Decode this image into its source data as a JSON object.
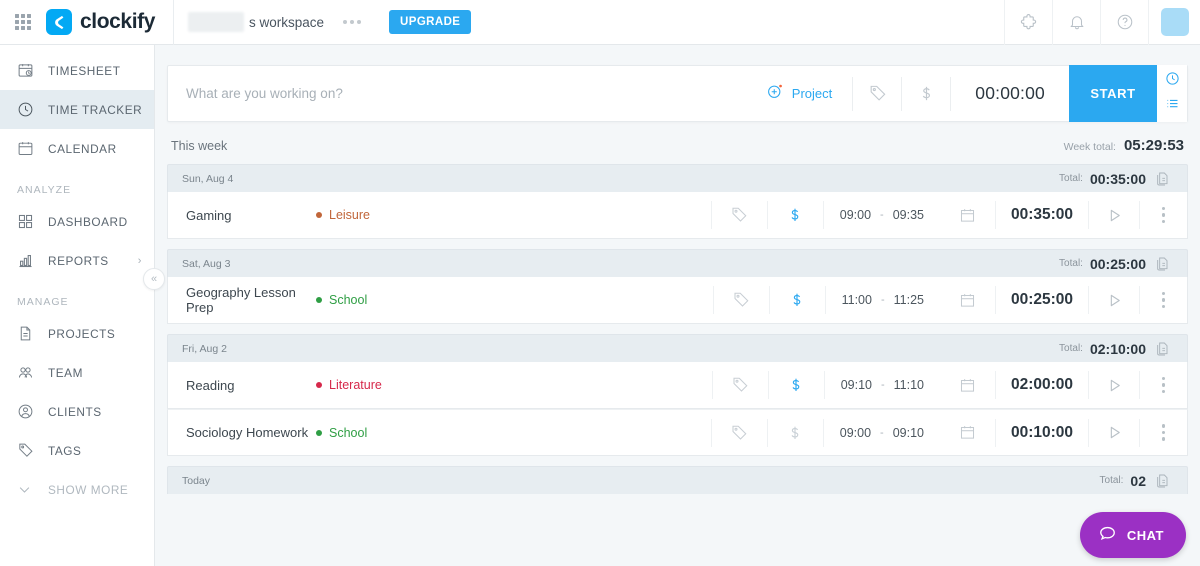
{
  "header": {
    "apps_icon": "grid-apps-icon",
    "brand_name": "clockify",
    "brand_icon": "clockify-logo-icon",
    "workspace_label": "s workspace",
    "workspace_menu_icon": "ellipsis-icon",
    "upgrade_label": "UPGRADE",
    "integrations_icon": "puzzle-icon",
    "notifications_icon": "bell-icon",
    "help_icon": "question-circle-icon",
    "avatar_icon": "user-avatar"
  },
  "sidebar": {
    "items": [
      {
        "label": "TIMESHEET",
        "icon": "timesheet-icon",
        "active": false
      },
      {
        "label": "TIME TRACKER",
        "icon": "clock-icon",
        "active": true
      },
      {
        "label": "CALENDAR",
        "icon": "calendar-icon",
        "active": false
      }
    ],
    "analyze_section": "ANALYZE",
    "analyze_items": [
      {
        "label": "DASHBOARD",
        "icon": "dashboard-grid-icon",
        "has_chevron": false
      },
      {
        "label": "REPORTS",
        "icon": "bar-chart-icon",
        "has_chevron": true
      }
    ],
    "manage_section": "MANAGE",
    "manage_items": [
      {
        "label": "PROJECTS",
        "icon": "document-icon"
      },
      {
        "label": "TEAM",
        "icon": "people-icon"
      },
      {
        "label": "CLIENTS",
        "icon": "person-circle-icon"
      },
      {
        "label": "TAGS",
        "icon": "tag-icon"
      }
    ],
    "show_more_label": "SHOW MORE",
    "show_more_icon": "chevron-down-icon",
    "collapse_icon": "double-chevron-left-icon"
  },
  "timer_bar": {
    "placeholder": "What are you working on?",
    "value": "",
    "project_label": "Project",
    "project_add_icon": "plus-circle-icon",
    "tag_icon": "tag-icon",
    "billable_icon": "dollar-icon",
    "duration": "00:00:00",
    "start_label": "START",
    "mode_timer_icon": "clock-icon",
    "mode_manual_icon": "list-icon"
  },
  "week": {
    "title": "This week",
    "total_label": "Week total:",
    "total_value": "05:29:53"
  },
  "colors": {
    "accent": "#2ba8f0",
    "billable_active": "#2ba8f0",
    "billable_inactive": "#c9d0d6",
    "chat_purple": "#9b30c4",
    "active_nav_bg": "#e4ecf1"
  },
  "day_groups": [
    {
      "date": "Sun, Aug 4",
      "total_label": "Total:",
      "total_value": "00:35:00",
      "edit_icon": "edit-duplicate-icon",
      "entries": [
        {
          "description": "Gaming",
          "project": "Leisure",
          "project_color": "#c1663a",
          "tag_icon": "tag-icon",
          "billable": true,
          "billable_icon": "dollar-icon",
          "start": "09:00",
          "end": "09:35",
          "calendar_icon": "calendar-icon",
          "duration": "00:35:00",
          "play_icon": "play-icon",
          "menu_icon": "vertical-ellipsis-icon"
        }
      ]
    },
    {
      "date": "Sat, Aug 3",
      "total_label": "Total:",
      "total_value": "00:25:00",
      "edit_icon": "edit-duplicate-icon",
      "entries": [
        {
          "description": "Geography Lesson Prep",
          "project": "School",
          "project_color": "#2f9e44",
          "tag_icon": "tag-icon",
          "billable": true,
          "billable_icon": "dollar-icon",
          "start": "11:00",
          "end": "11:25",
          "calendar_icon": "calendar-icon",
          "duration": "00:25:00",
          "play_icon": "play-icon",
          "menu_icon": "vertical-ellipsis-icon"
        }
      ]
    },
    {
      "date": "Fri, Aug 2",
      "total_label": "Total:",
      "total_value": "02:10:00",
      "edit_icon": "edit-duplicate-icon",
      "entries": [
        {
          "description": "Reading",
          "project": "Literature",
          "project_color": "#d6294b",
          "tag_icon": "tag-icon",
          "billable": true,
          "billable_icon": "dollar-icon",
          "start": "09:10",
          "end": "11:10",
          "calendar_icon": "calendar-icon",
          "duration": "02:00:00",
          "play_icon": "play-icon",
          "menu_icon": "vertical-ellipsis-icon"
        },
        {
          "description": "Sociology Homework",
          "project": "School",
          "project_color": "#2f9e44",
          "tag_icon": "tag-icon",
          "billable": false,
          "billable_icon": "dollar-icon",
          "start": "09:00",
          "end": "09:10",
          "calendar_icon": "calendar-icon",
          "duration": "00:10:00",
          "play_icon": "play-icon",
          "menu_icon": "vertical-ellipsis-icon"
        }
      ]
    },
    {
      "date": "Today",
      "total_label": "Total:",
      "total_value": "02",
      "edit_icon": "edit-duplicate-icon",
      "entries": []
    }
  ],
  "chat": {
    "label": "CHAT",
    "icon": "chat-bubble-icon"
  }
}
